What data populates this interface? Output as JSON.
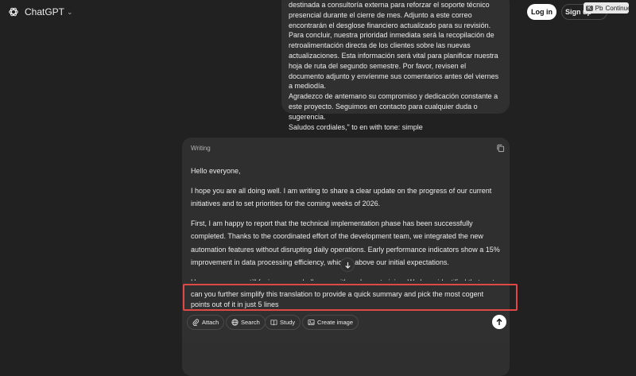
{
  "header": {
    "app_title": "ChatGPT",
    "login_label": "Log in",
    "signup_label": "Sign up",
    "continue_key": "K",
    "continue_label": "Continue",
    "continue_prefix": "Pb"
  },
  "user_message": {
    "lines": [
      "destinada a consultoría externa para reforzar el soporte técnico presencial durante el cierre de mes. Adjunto a este correo encontrarán el desglose financiero actualizado para su revisión.",
      "Para concluir, nuestra prioridad inmediata será la recopilación de retroalimentación directa de los clientes sobre las nuevas actualizaciones. Esta información será vital para planificar nuestra hoja de ruta del segundo semestre. Por favor, revisen el documento adjunto y envíenme sus comentarios antes del viernes a mediodía.",
      "Agradezco de antemano su compromiso y dedicación constante a este proyecto. Seguimos en contacto para cualquier duda o sugerencia.",
      "Saludos cordiales,\" to en with tone: simple"
    ]
  },
  "response_card": {
    "label": "Writing",
    "paragraphs": [
      "Hello everyone,",
      "I hope you are all doing well. I am writing to share a clear update on the progress of our current initiatives and to set priorities for the coming weeks of 2026.",
      "First, I am happy to report that the technical implementation phase has been successfully completed. Thanks to the coordinated effort of the development team, we integrated the new automation features without disrupting daily operations. Early performance indicators show a 15% improvement in data processing efficiency, which is above our initial expectations.",
      "However, we are still facing some challenges with end-user training. We have identified that part of the"
    ]
  },
  "composer": {
    "prompt_text": "can you further simplify this translation to provide a quick summary and pick the most cogent points out of it in just 5 lines",
    "attach_label": "Attach",
    "search_label": "Search",
    "study_label": "Study",
    "create_image_label": "Create image"
  }
}
